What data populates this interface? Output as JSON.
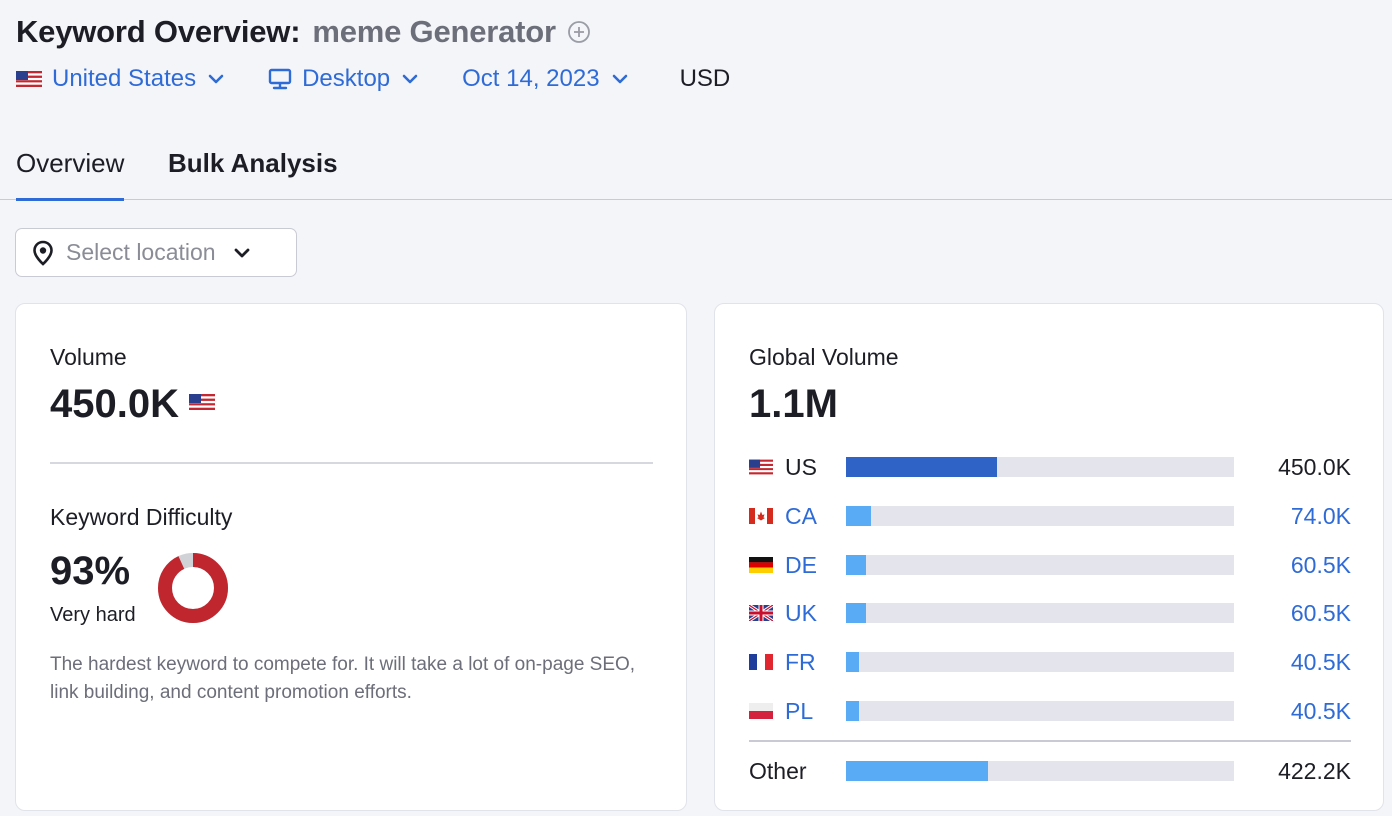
{
  "header": {
    "title": "Keyword Overview:",
    "keyword": "meme Generator",
    "add_icon": "plus-circle-icon"
  },
  "filters": {
    "country": "United States",
    "device": "Desktop",
    "date": "Oct 14, 2023",
    "currency": "USD"
  },
  "tabs": [
    {
      "label": "Overview",
      "active": true
    },
    {
      "label": "Bulk Analysis",
      "active": false
    }
  ],
  "location_select": {
    "placeholder": "Select location",
    "icon": "map-pin-icon"
  },
  "volume": {
    "label": "Volume",
    "value": "450.0K"
  },
  "keyword_difficulty": {
    "label": "Keyword Difficulty",
    "value": "93%",
    "percent": 93,
    "rating": "Very hard",
    "description": "The hardest keyword to compete for. It will take a lot of on-page SEO, link building, and content promotion efforts.",
    "color": "#c0262d"
  },
  "global_volume": {
    "label": "Global Volume",
    "value": "1.1M",
    "countries": [
      {
        "code": "US",
        "value": "450.0K",
        "share": 0.39,
        "link": false,
        "bar_color": "#2f64c6"
      },
      {
        "code": "CA",
        "value": "74.0K",
        "share": 0.064,
        "link": true,
        "bar_color": "#5aabf5"
      },
      {
        "code": "DE",
        "value": "60.5K",
        "share": 0.052,
        "link": true,
        "bar_color": "#5aabf5"
      },
      {
        "code": "UK",
        "value": "60.5K",
        "share": 0.052,
        "link": true,
        "bar_color": "#5aabf5"
      },
      {
        "code": "FR",
        "value": "40.5K",
        "share": 0.034,
        "link": true,
        "bar_color": "#5aabf5"
      },
      {
        "code": "PL",
        "value": "40.5K",
        "share": 0.034,
        "link": true,
        "bar_color": "#5aabf5"
      }
    ],
    "other": {
      "label": "Other",
      "value": "422.2K",
      "share": 0.367,
      "bar_color": "#5aabf5"
    }
  }
}
